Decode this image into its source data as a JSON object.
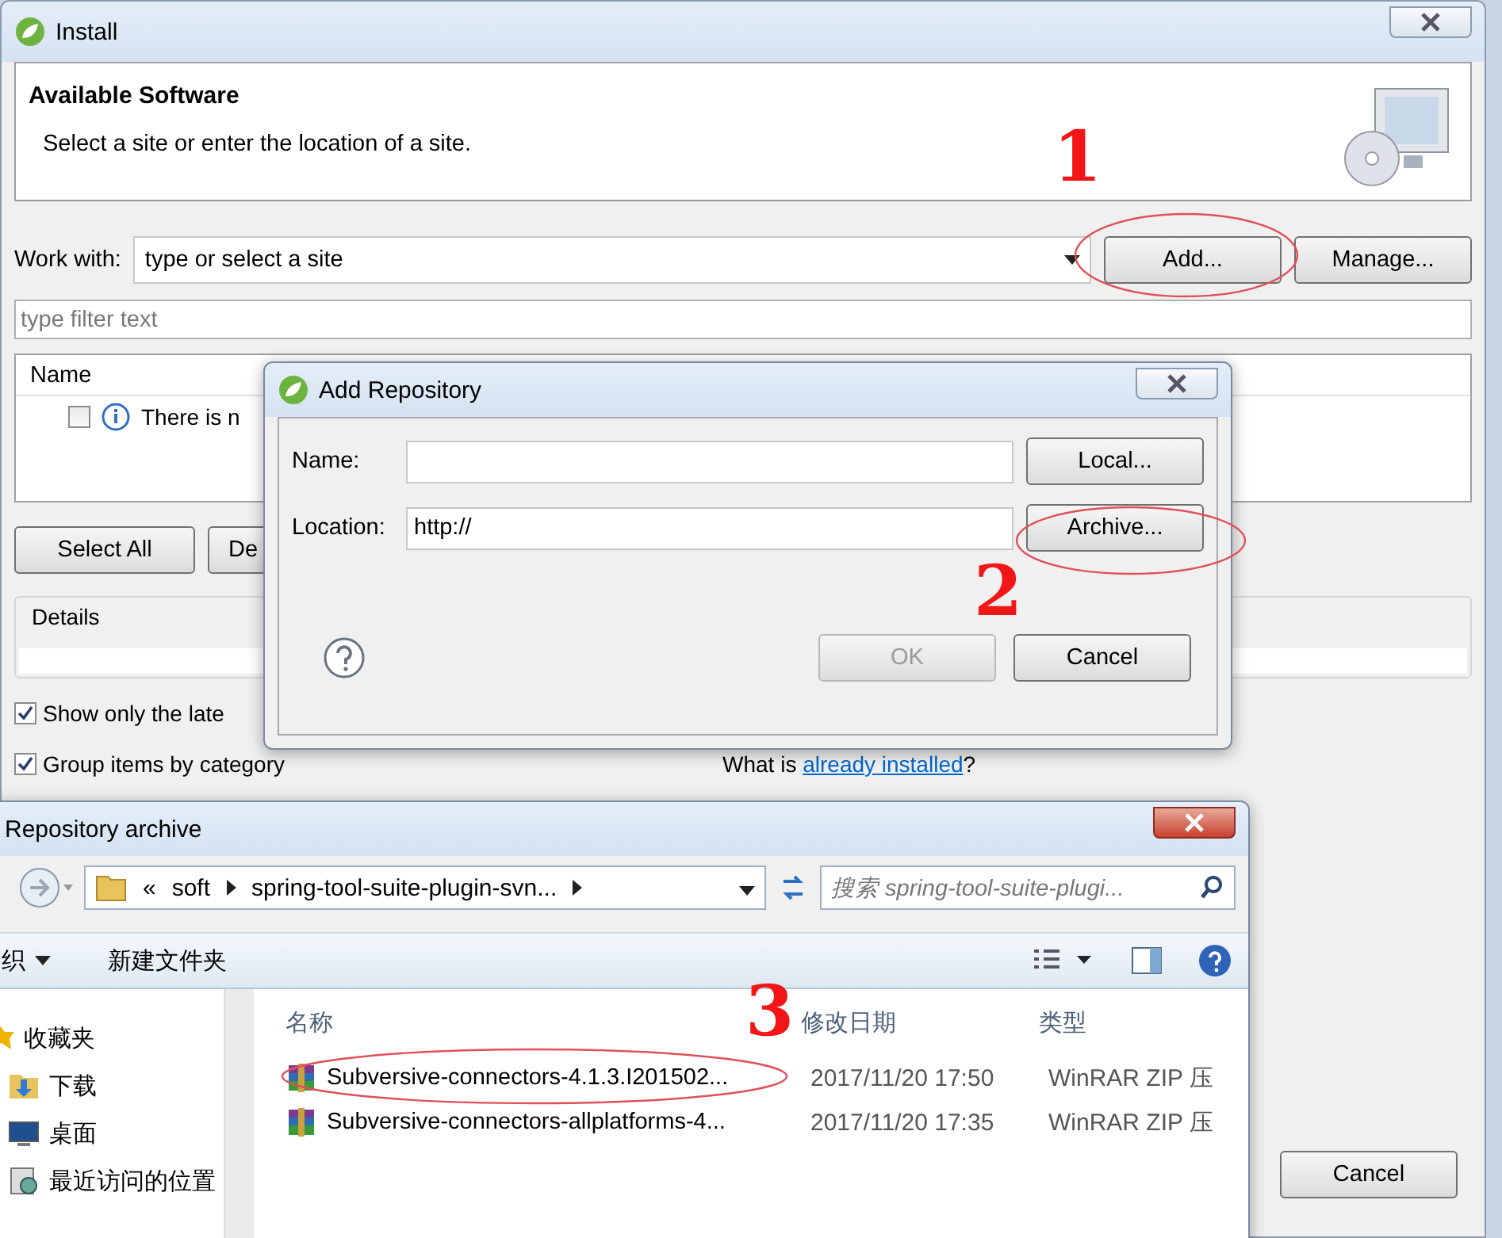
{
  "install": {
    "title": "Install",
    "header_title": "Available Software",
    "header_subtitle": "Select a site or enter the location of a site.",
    "work_with_label": "Work with:",
    "work_with_value": "type or select a site",
    "site_buttons": [
      "Add...",
      "Manage..."
    ],
    "filter_placeholder": "type filter text",
    "table": {
      "columns": [
        "Name"
      ],
      "rows": [
        {
          "text": "There is n",
          "checked": false
        }
      ]
    },
    "select_buttons": [
      "Select All",
      "De"
    ],
    "details_label": "Details",
    "options": [
      {
        "label": "Show only the late",
        "checked": true
      },
      {
        "label": "Group items by category",
        "checked": true
      }
    ],
    "installed_prefix": "What is",
    "installed_link": "already installed",
    "installed_suffix": "?",
    "cancel": "Cancel"
  },
  "add_repository": {
    "title": "Add Repository",
    "fields": [
      {
        "label": "Name:",
        "button": "Local..."
      },
      {
        "label": "Location:",
        "value": "http://",
        "button": "Archive..."
      }
    ],
    "ok": {
      "label": "OK",
      "disabled": true
    },
    "cancel": "Cancel"
  },
  "file_dialog": {
    "title": "Repository archive",
    "path_prefix": "«",
    "path": [
      "soft",
      "spring-tool-suite-plugin-svn..."
    ],
    "search_placeholder": "搜索 spring-tool-suite-plugi...",
    "organize": "织",
    "new_folder": "新建文件夹",
    "nav": [
      {
        "label": "收藏夹",
        "kind": "star"
      },
      {
        "label": "下载",
        "kind": "download"
      },
      {
        "label": "桌面",
        "kind": "desktop"
      },
      {
        "label": "最近访问的位置",
        "kind": "recent"
      }
    ],
    "columns": [
      "名称",
      "修改日期",
      "类型"
    ],
    "files": [
      {
        "name": "Subversive-connectors-4.1.3.I201502...",
        "date": "2017/11/20 17:50",
        "type": "WinRAR ZIP 压"
      },
      {
        "name": "Subversive-connectors-allplatforms-4...",
        "date": "2017/11/20 17:35",
        "type": "WinRAR ZIP 压"
      }
    ]
  },
  "annotations": [
    {
      "text": "1"
    },
    {
      "text": "2"
    },
    {
      "text": "3"
    }
  ]
}
